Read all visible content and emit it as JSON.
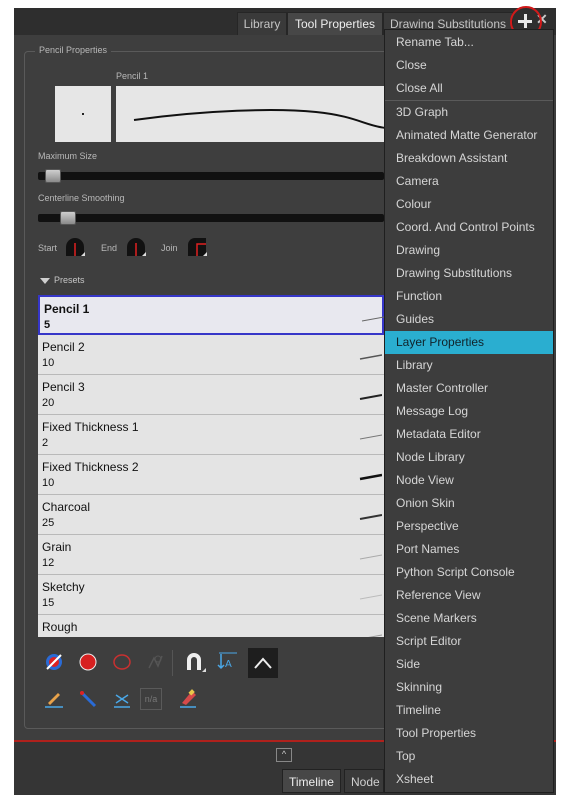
{
  "tabs": [
    "Library",
    "Tool Properties",
    "Drawing Substitutions"
  ],
  "active_tab": "Tool Properties",
  "pencil_properties": {
    "section_label": "Pencil Properties",
    "preset_name": "Pencil 1",
    "max_size_label": "Maximum Size",
    "max_size_level": 0.04,
    "smoothing_label": "Centerline Smoothing",
    "smoothing_level": 0.08,
    "start_label": "Start",
    "end_label": "End",
    "join_label": "Join",
    "presets_label": "Presets"
  },
  "presets": [
    {
      "name": "Pencil 1",
      "size": "5",
      "selected": true
    },
    {
      "name": "Pencil 2",
      "size": "10",
      "selected": false
    },
    {
      "name": "Pencil 3",
      "size": "20",
      "selected": false
    },
    {
      "name": "Fixed Thickness 1",
      "size": "2",
      "selected": false
    },
    {
      "name": "Fixed Thickness 2",
      "size": "10",
      "selected": false
    },
    {
      "name": "Charcoal",
      "size": "25",
      "selected": false
    },
    {
      "name": "Grain",
      "size": "12",
      "selected": false
    },
    {
      "name": "Sketchy",
      "size": "15",
      "selected": false
    },
    {
      "name": "Rough",
      "size": "",
      "selected": false
    }
  ],
  "tool_buttons_row1": [
    "pencil-new-icon",
    "red-dot-icon",
    "red-outline-icon",
    "brush-stroke-icon",
    "magnet-icon",
    "size-arrow-icon",
    "caret-up-icon"
  ],
  "tool_buttons_row2": [
    "pencil-line-icon",
    "pen-blue-icon",
    "pen-cross-icon",
    "na-icon",
    "eraser-brush-icon"
  ],
  "tool_na_text": "n/a",
  "bottom_tabs": [
    "Timeline",
    "Node"
  ],
  "menu": {
    "top_items": [
      "Rename Tab...",
      "Close",
      "Close All"
    ],
    "items": [
      "3D Graph",
      "Animated Matte Generator",
      "Breakdown Assistant",
      "Camera",
      "Colour",
      "Coord. And Control Points",
      "Drawing",
      "Drawing Substitutions",
      "Function",
      "Guides",
      "Layer Properties",
      "Library",
      "Master Controller",
      "Message Log",
      "Metadata Editor",
      "Node Library",
      "Node View",
      "Onion Skin",
      "Perspective",
      "Port Names",
      "Python Script Console",
      "Reference View",
      "Scene Markers",
      "Script Editor",
      "Side",
      "Skinning",
      "Timeline",
      "Tool Properties",
      "Top",
      "Xsheet"
    ],
    "highlighted": "Layer Properties"
  },
  "colors": {
    "highlight": "#2aaed0",
    "selected_preset_border": "#3636c8",
    "annotation_circle": "#d11a1a"
  }
}
